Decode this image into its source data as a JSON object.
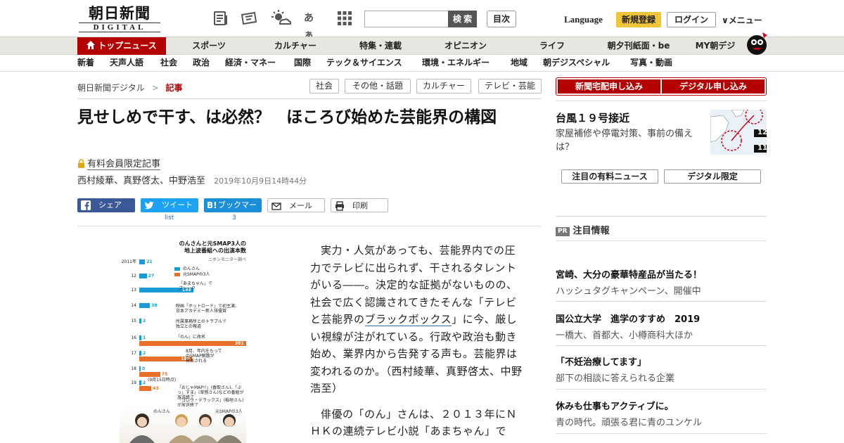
{
  "header": {
    "logo_main": "朝日新聞",
    "logo_sub": "DIGITAL",
    "search_placeholder": "",
    "search_button": "検 索",
    "toc_button": "目次",
    "kana_icon_text": "あぁ",
    "language": "Language",
    "register": "新規登録",
    "login": "ログイン",
    "menu": "∨メニュー"
  },
  "nav_primary": [
    {
      "label": "トップニュース"
    },
    {
      "label": "スポーツ"
    },
    {
      "label": "カルチャー"
    },
    {
      "label": "特集・連載"
    },
    {
      "label": "オピニオン"
    },
    {
      "label": "ライフ"
    },
    {
      "label": "朝夕刊紙面・be"
    },
    {
      "label": "MY朝デジ"
    }
  ],
  "nav_secondary": [
    {
      "label": "新着"
    },
    {
      "label": "天声人語"
    },
    {
      "label": "社会"
    },
    {
      "label": "政治"
    },
    {
      "label": "経済・マネー"
    },
    {
      "label": "国際"
    },
    {
      "label": "テック＆サイエンス"
    },
    {
      "label": "環境・エネルギー"
    },
    {
      "label": "地域"
    },
    {
      "label": "朝デジスペシャル"
    },
    {
      "label": "写真・動画"
    }
  ],
  "breadcrumb": {
    "root": "朝日新聞デジタル",
    "separator": ">",
    "current": "記事"
  },
  "tags": [
    "社会",
    "その他・話題",
    "カルチャー",
    "テレビ・芸能"
  ],
  "article": {
    "title": "見せしめで干す、は必然？　ほころび始めた芸能界の構図",
    "premium_label": "有料会員限定記事",
    "authors": "西村綾華、真野啓太、中野浩至",
    "date": "2019年10月9日14時44分",
    "para1_a": "実力・人気があっても、芸能界内での圧力でテレビに出られず、干されるタレントがいる――。決定的な証拠がないものの、社会で広く認識されてきたそんな「テレビと芸能界の",
    "para1_link": "ブラックボックス",
    "para1_b": "」に今、厳しい視線が注がれている。行政や政治も動き始め、業界内から告発する声も。芸能界は変われるのか。（西村綾華、真野啓太、中野浩至）",
    "para2": "俳優の「のん」さんは、２０１３年にＮＨＫの連続テレビ小説「あまちゃん」で"
  },
  "share": {
    "facebook": "シェア",
    "twitter": "ツイート",
    "hatena_icon": "B!",
    "hatena": "ブックマーク",
    "mail": "メール",
    "print": "印刷",
    "twitter_count": "list",
    "hatena_count": "3"
  },
  "chart_data": {
    "type": "bar",
    "title": "のんさんと元SMAP3人の\n地上波番組への出演本数",
    "source": "ニホンモニター調べ",
    "categories": [
      "2011年",
      "12",
      "13",
      "14",
      "15",
      "16",
      "17",
      "18",
      "19"
    ],
    "series": [
      {
        "name": "のんさん",
        "color": "#1a9ad6",
        "values": [
          21,
          27,
          193,
          38,
          2,
          1,
          2,
          0,
          2
        ]
      },
      {
        "name": "元SMAPの3人",
        "color": "#e8702a",
        "values": [
          null,
          null,
          null,
          null,
          null,
          381,
          189,
          75,
          43
        ]
      }
    ],
    "annotations": [
      "「あまちゃん」で\nブレーク",
      "映画「ホットロード」で初主演、\n日本アカデミー新人俳優賞",
      "所属事務所とのトラブルで\n独立との報道",
      "「のん」に改名",
      "8月、年内をもって\nのSMAP解散が\n発表される",
      "「おじゃMAP!!」(香取さん)、「ぷっ」すま」(草彅さん)などの番組が放送終了",
      "(9月15日時点)",
      "「ゴロウ・デラックス」(稲垣さん)が放送終了"
    ],
    "photo_captions": [
      "のんさん",
      "元SMAPの3人"
    ]
  },
  "sidebar": {
    "subscribe_paper": "新聞宅配申し込み",
    "subscribe_digital": "デジタル申し込み",
    "typhoon_title": "台風１９号接近",
    "typhoon_desc": "家屋補修や停電対策、事前の備えは？",
    "map_label_1": "12",
    "map_label_2": "11",
    "tab_paid": "注目の有料ニュース",
    "tab_digital": "デジタル限定",
    "pr_badge": "PR",
    "pr_heading": "注目情報",
    "pr_items": [
      {
        "title": "宮崎、大分の豪華特産品が当たる！",
        "desc": "ハッシュタグキャンペーン、開催中"
      },
      {
        "title": "国公立大学　進学のすすめ　2019",
        "desc": "一橋大、首都大、小樽商科大ほか"
      },
      {
        "title": "「不妊治療してます」",
        "desc": "部下の相談に答えられる企業"
      },
      {
        "title": "休みも仕事もアクティブに。",
        "desc": "青の時代。頑張る君に青のユンケル"
      }
    ]
  },
  "colors": {
    "brand_red": "#b30000",
    "register_yellow": "#f0c53a",
    "facebook": "#3b5998",
    "twitter": "#1da1f2",
    "hatena": "#1a8fd8"
  }
}
